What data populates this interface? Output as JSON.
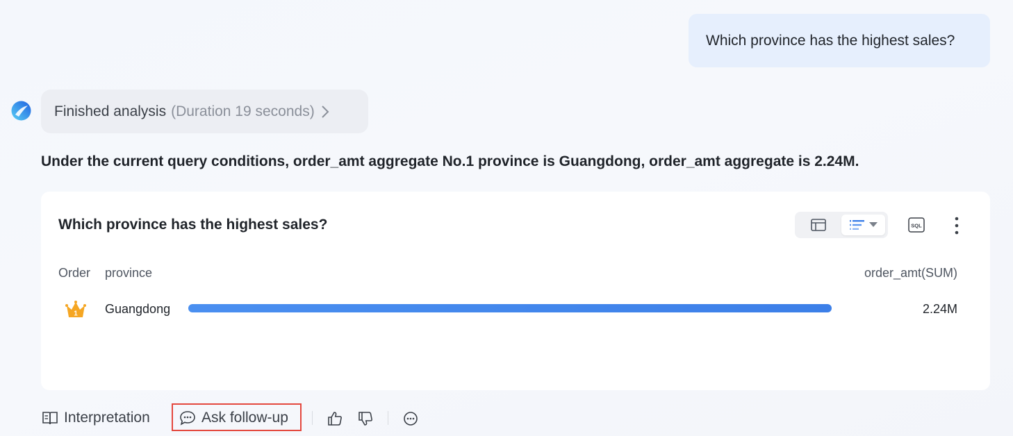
{
  "user_message": "Which province has the highest sales?",
  "status": {
    "main": "Finished analysis",
    "duration": "(Duration 19 seconds)"
  },
  "answer": "Under the current query conditions, order_amt aggregate No.1 province is Guangdong, order_amt aggregate is 2.24M.",
  "card": {
    "title": "Which province has the highest sales?",
    "sql_label": "SQL",
    "columns": {
      "order": "Order",
      "province": "province",
      "metric": "order_amt(SUM)"
    },
    "rows": [
      {
        "rank": "1",
        "province": "Guangdong",
        "value": "2.24M",
        "bar_fraction": 1.0
      }
    ],
    "active_view": "bar-ranking"
  },
  "actions": {
    "interpretation": "Interpretation",
    "ask_follow_up": "Ask follow-up"
  },
  "colors": {
    "accent": "#3c7fe8",
    "highlight_border": "#e4473d",
    "crown": "#f5a623"
  }
}
